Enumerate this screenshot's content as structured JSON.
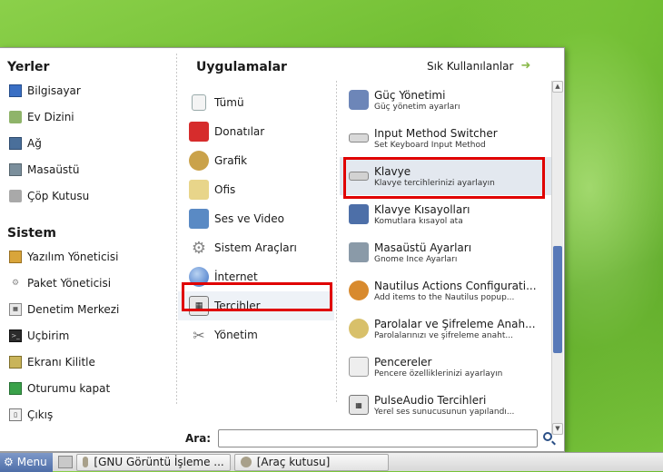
{
  "places": {
    "title": "Yerler",
    "items": [
      {
        "label": "Bilgisayar",
        "icon": "computer-icon"
      },
      {
        "label": "Ev Dizini",
        "icon": "home-folder-icon"
      },
      {
        "label": "Ağ",
        "icon": "network-icon"
      },
      {
        "label": "Masaüstü",
        "icon": "desktop-icon"
      },
      {
        "label": "Çöp Kutusu",
        "icon": "trash-icon"
      }
    ]
  },
  "system": {
    "title": "Sistem",
    "items": [
      {
        "label": "Yazılım Yöneticisi",
        "icon": "package-icon"
      },
      {
        "label": "Paket Yöneticisi",
        "icon": "gear-icon"
      },
      {
        "label": "Denetim Merkezi",
        "icon": "control-center-icon"
      },
      {
        "label": "Uçbirim",
        "icon": "terminal-icon"
      },
      {
        "label": "Ekranı Kilitle",
        "icon": "lock-screen-icon"
      },
      {
        "label": "Oturumu kapat",
        "icon": "logout-icon"
      },
      {
        "label": "Çıkış",
        "icon": "quit-icon"
      }
    ]
  },
  "applications": {
    "title": "Uygulamalar",
    "favorites_label": "Sık Kullanılanlar",
    "categories": [
      {
        "label": "Tümü",
        "icon": "all-apps-icon"
      },
      {
        "label": "Donatılar",
        "icon": "accessories-icon"
      },
      {
        "label": "Grafik",
        "icon": "graphics-icon"
      },
      {
        "label": "Ofis",
        "icon": "office-icon"
      },
      {
        "label": "Ses ve Video",
        "icon": "multimedia-icon"
      },
      {
        "label": "Sistem Araçları",
        "icon": "system-tools-icon"
      },
      {
        "label": "İnternet",
        "icon": "internet-icon"
      },
      {
        "label": "Tercihler",
        "icon": "preferences-icon"
      },
      {
        "label": "Yönetim",
        "icon": "administration-icon"
      }
    ],
    "selected_category": "Tercihler",
    "apps": [
      {
        "name": "Güç Yönetimi",
        "desc": "Güç yönetim ayarları",
        "icon": "power-icon"
      },
      {
        "name": "Input Method Switcher",
        "desc": "Set Keyboard Input Method",
        "icon": "keyboard-icon"
      },
      {
        "name": "Klavye",
        "desc": "Klavye tercihlerinizi ayarlayın",
        "icon": "keyboard-icon"
      },
      {
        "name": "Klavye Kısayolları",
        "desc": "Komutlara kısayol ata",
        "icon": "shortcuts-icon"
      },
      {
        "name": "Masaüstü Ayarları",
        "desc": "Gnome İnce Ayarları",
        "icon": "desktop-settings-icon"
      },
      {
        "name": "Nautilus Actions Configurati...",
        "desc": "Add items to the Nautilus popup...",
        "icon": "nautilus-icon"
      },
      {
        "name": "Parolalar ve Şifreleme Anah...",
        "desc": "Parolalarınızı ve şifreleme anaht...",
        "icon": "keys-icon"
      },
      {
        "name": "Pencereler",
        "desc": "Pencere özelliklerinizi ayarlayın",
        "icon": "windows-icon"
      },
      {
        "name": "PulseAudio Tercihleri",
        "desc": "Yerel ses sunucusunun yapılandı...",
        "icon": "audio-icon"
      }
    ],
    "highlighted_app": "Klavye"
  },
  "search": {
    "label": "Ara:",
    "value": ""
  },
  "taskbar": {
    "menu_label": "Menu",
    "tasks": [
      "[GNU Görüntü İşleme ...",
      "[Araç kutusu]"
    ]
  },
  "colors": {
    "annotation": "#e00000",
    "scroll_thumb": "#5879b8"
  }
}
